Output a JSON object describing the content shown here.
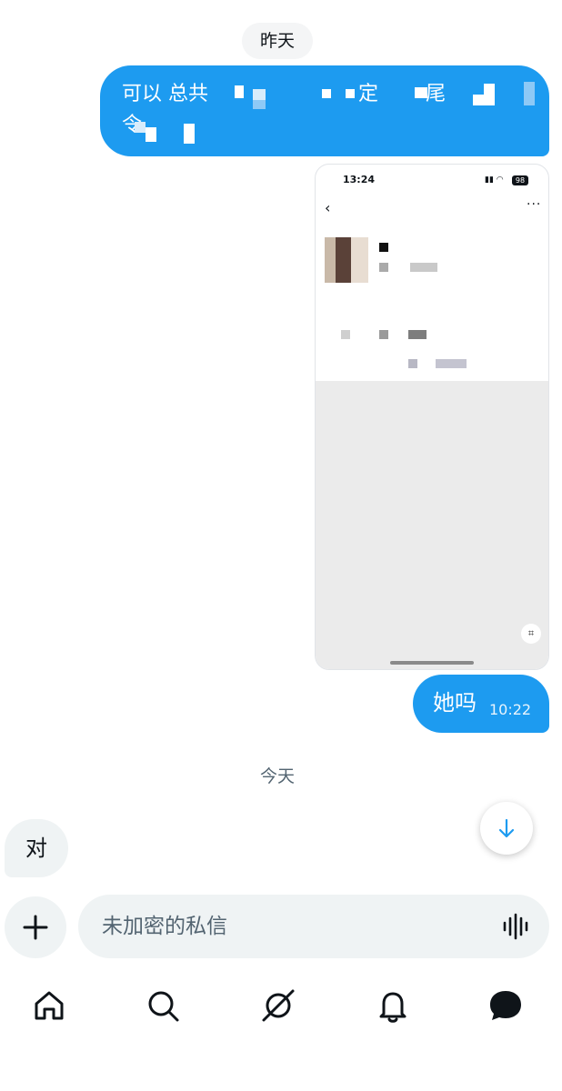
{
  "conversation": {
    "date_yesterday": "昨天",
    "date_today": "今天",
    "messages": [
      {
        "direction": "out",
        "text_line1": "可以 总共",
        "text_line1_b": "定",
        "text_line1_c": "尾",
        "text_line2": "令",
        "pixelated": true
      },
      {
        "direction": "out",
        "type": "image",
        "image": {
          "status_time": "13:24",
          "battery": "98"
        }
      },
      {
        "direction": "out",
        "text": "她吗",
        "time": "10:22"
      },
      {
        "direction": "in",
        "text": "对"
      }
    ]
  },
  "composer": {
    "placeholder": "未加密的私信"
  },
  "icons": {
    "add": "plus-icon",
    "voice": "voice-waveform-icon",
    "scroll_down": "arrow-down-icon",
    "tabs": [
      "home-icon",
      "search-icon",
      "grok-icon",
      "bell-icon",
      "messages-icon"
    ]
  },
  "colors": {
    "accent": "#1d9bf0",
    "incoming_bubble": "#eff3f4",
    "text_secondary": "#536471"
  }
}
